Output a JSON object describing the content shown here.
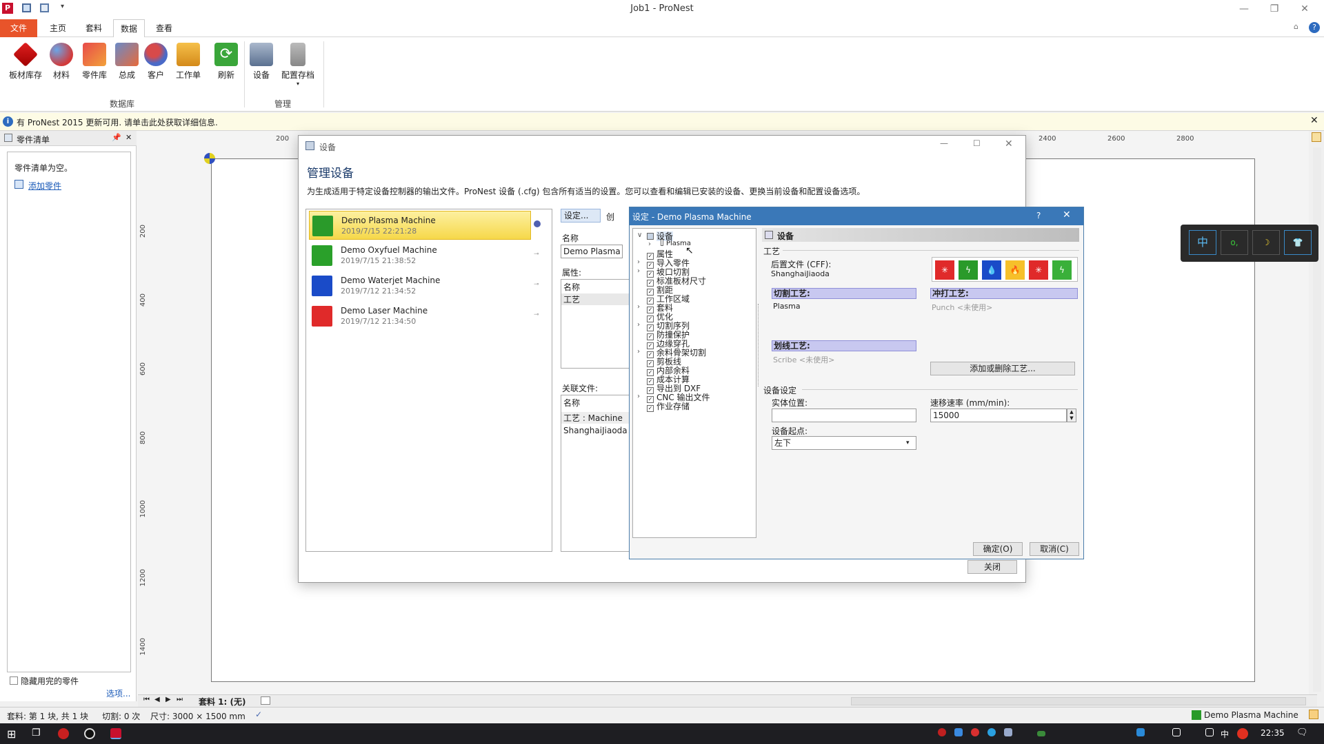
{
  "window": {
    "title": "Job1 - ProNest"
  },
  "ribbon": {
    "tabs": [
      "文件",
      "主页",
      "套料",
      "数据",
      "查看"
    ],
    "buttons": [
      "板材库存",
      "材料",
      "零件库",
      "总成",
      "客户",
      "工作单",
      "刷新",
      "设备",
      "配置存档"
    ],
    "groups": [
      "数据库",
      "管理"
    ]
  },
  "infobar": {
    "text": "有 ProNest 2015 更新可用. 请单击此处获取详细信息."
  },
  "parts_panel": {
    "title": "零件清单",
    "empty_text": "零件清单为空。",
    "add_link": "添加零件",
    "hide_checkbox": "隐藏用完的零件",
    "options_link": "选项..."
  },
  "ruler": {
    "h": [
      "200",
      "2400",
      "2600",
      "2800"
    ],
    "v": [
      "200",
      "400",
      "600",
      "800",
      "1000",
      "1200",
      "1400"
    ]
  },
  "manage_dialog": {
    "title": "设备",
    "heading": "管理设备",
    "description": "为生成适用于特定设备控制器的输出文件。ProNest 设备 (.cfg) 包含所有适当的设置。您可以查看和编辑已安装的设备、更换当前设备和配置设备选项。",
    "machines": [
      {
        "name": "Demo Plasma Machine",
        "date": "2019/7/15 22:21:28",
        "color": "#2a9a2a"
      },
      {
        "name": "Demo Oxyfuel Machine",
        "date": "2019/7/15 21:38:52",
        "color": "#2aa02a"
      },
      {
        "name": "Demo Waterjet Machine",
        "date": "2019/7/12 21:34:52",
        "color": "#1a4bc8"
      },
      {
        "name": "Demo Laser Machine",
        "date": "2019/7/12 21:34:50",
        "color": "#e02a2a"
      }
    ],
    "toolbar_settings": "设定...",
    "toolbar_create": "创",
    "name_label": "名称",
    "name_value": "Demo Plasma Mac",
    "props_label": "属性:",
    "props_rows": [
      "名称",
      "工艺"
    ],
    "files_label": "关联文件:",
    "files_col": "名称",
    "files_group": "工艺 : Machine",
    "files_value": "ShanghaiJiaoda.cfl",
    "close_button": "关闭"
  },
  "settings_dialog": {
    "title": "设定 - Demo Plasma Machine",
    "help": "?",
    "tree": [
      "设备",
      "Plasma",
      "属性",
      "导入零件",
      "坡口切割",
      "标准板材尺寸",
      "割距",
      "工作区域",
      "套料",
      "优化",
      "切割序列",
      "防撞保护",
      "边缘穿孔",
      "余料骨架切割",
      "剪板线",
      "内部余料",
      "成本计算",
      "导出到 DXF",
      "CNC 输出文件",
      "作业存储"
    ],
    "section_title": "设备",
    "process_group": "工艺",
    "post_label": "后置文件 (CFF):",
    "post_value": "ShanghaiJiaoda",
    "cut_label": "切割工艺:",
    "cut_value": "Plasma",
    "punch_label": "冲打工艺:",
    "punch_value": "Punch  <未使用>",
    "scribe_label": "划线工艺:",
    "scribe_value": "Scribe  <未使用>",
    "add_remove_button": "添加或删除工艺...",
    "machine_settings": "设备设定",
    "home_label": "实体位置:",
    "home_value": "",
    "traverse_label": "速移速率 (mm/min):",
    "traverse_value": "15000",
    "origin_label": "设备起点:",
    "origin_value": "左下",
    "ok": "确定(O)",
    "cancel": "取消(C)"
  },
  "bottom": {
    "nest_tab": "套料 1: (无)"
  },
  "status": {
    "sheets": "套料: 第 1 块, 共 1 块",
    "cuts": "切割: 0 次",
    "size": "尺寸: 3000 × 1500 mm",
    "machine": "Demo Plasma Machine"
  },
  "ime": {
    "lang": "中"
  },
  "taskbar": {
    "ime": "中",
    "time": "22:35"
  }
}
